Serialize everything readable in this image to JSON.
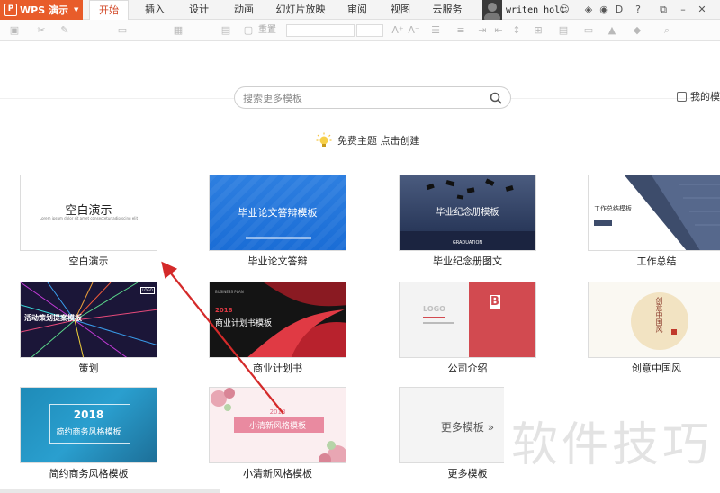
{
  "app": {
    "name": "WPS 演示"
  },
  "tabs": [
    {
      "label": "开始",
      "active": true
    },
    {
      "label": "插入"
    },
    {
      "label": "设计"
    },
    {
      "label": "动画"
    },
    {
      "label": "幻灯片放映"
    },
    {
      "label": "审阅"
    },
    {
      "label": "视图"
    },
    {
      "label": "云服务"
    }
  ],
  "user": {
    "name": "writen holt"
  },
  "ribbon": {
    "reset_label": "重置"
  },
  "search": {
    "placeholder": "搜索更多模板"
  },
  "my_templates": {
    "label": "我的模"
  },
  "free_theme": {
    "label": "免费主题  点击创建"
  },
  "templates": [
    {
      "label": "空白演示",
      "thumb_title": "空白演示",
      "thumb_sub": "Lorem ipsum dolor sit amet consectetur adipiscing elit"
    },
    {
      "label": "毕业论文答辩",
      "thumb_title": "毕业论文答辩模板"
    },
    {
      "label": "毕业纪念册图文",
      "thumb_title": "毕业纪念册模板",
      "thumb_sub": "GRADUATION"
    },
    {
      "label": "工作总结",
      "thumb_title": "工作总结模板"
    },
    {
      "label": "策划",
      "thumb_title": "活动策划提案模板",
      "thumb_badge": "LOGO"
    },
    {
      "label": "商业计划书",
      "thumb_title": "商业计划书模板",
      "thumb_year": "2018",
      "thumb_sub": "BUSINESS PLAN"
    },
    {
      "label": "公司介绍",
      "thumb_title": "LOGO",
      "thumb_letter": "B"
    },
    {
      "label": "创意中国风",
      "thumb_title": "创意中国风"
    },
    {
      "label": "简约商务风格模板",
      "thumb_year": "2018",
      "thumb_title": "简约商务风格模板"
    },
    {
      "label": "小清新风格模板",
      "thumb_year": "2018",
      "thumb_title": "小清新风格模板"
    },
    {
      "label": "更多模板",
      "thumb_title": "更多模板 »"
    }
  ],
  "watermark": "软件技巧",
  "colors": {
    "accent": "#e85c2a",
    "arrow": "#d42a2a",
    "active_tab": "#d24726"
  }
}
